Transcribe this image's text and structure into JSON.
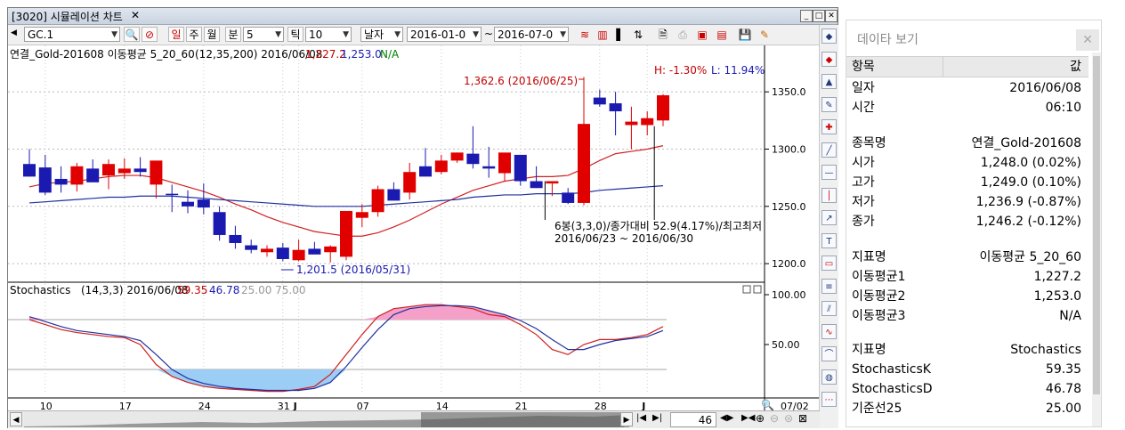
{
  "window": {
    "title": "[3020] 시뮬레이션 차트"
  },
  "toolbar": {
    "symbol": "GC.1",
    "period_day": "일",
    "period_week": "주",
    "period_month": "월",
    "period_minute": "분",
    "minute_value": "5",
    "period_tick": "틱",
    "tick_value": "10",
    "mode": "날자",
    "date_from": "2016-01-0",
    "range_sep": "~",
    "date_to": "2016-07-0"
  },
  "main_chart": {
    "legend_name": "연결_Gold-201608 이동평균 5_20_60",
    "legend_params": "(12,35,200) 2016/06/08",
    "legend_v1": "1,227.2",
    "legend_v2": "1,253.0",
    "legend_v3": "N/A",
    "high_pct": "H: -1.30%",
    "low_pct": "L: 11.94%",
    "max_label": "1,362.6 (2016/06/25)",
    "min_label": "1,201.5 (2016/05/31)",
    "annot_line1": "6봉(3,3,0)/종가대비 52.9(4.17%)/최고최저",
    "annot_line2": "2016/06/23 ~ 2016/06/30",
    "y_ticks": [
      "1350.0",
      "1300.0",
      "1250.0",
      "1200.0"
    ]
  },
  "sub_chart": {
    "legend_name": "Stochastics",
    "legend_params": "(14,3,3) 2016/06/08",
    "legend_k": "59.35",
    "legend_d": "46.78",
    "legend_base": "25.00 75.00",
    "y_ticks": [
      "100.00",
      "50.00"
    ]
  },
  "x_axis": {
    "labels": [
      "10",
      "17",
      "24",
      "31",
      "J",
      "07",
      "14",
      "21",
      "28",
      "J"
    ],
    "end_label": "07/02"
  },
  "scroll": {
    "count": "46"
  },
  "chart_data": [
    {
      "type": "candlestick",
      "title": "연결_Gold-201608",
      "ylim": [
        1190,
        1375
      ],
      "x": [
        "05/09",
        "05/10",
        "05/11",
        "05/12",
        "05/13",
        "05/16",
        "05/17",
        "05/18",
        "05/19",
        "05/20",
        "05/23",
        "05/24",
        "05/25",
        "05/26",
        "05/27",
        "05/30",
        "05/31",
        "06/01",
        "06/02",
        "06/03",
        "06/06",
        "06/07",
        "06/08",
        "06/09",
        "06/10",
        "06/13",
        "06/14",
        "06/15",
        "06/16",
        "06/17",
        "06/20",
        "06/21",
        "06/22",
        "06/23",
        "06/24",
        "06/25",
        "06/27",
        "06/28",
        "06/29",
        "06/30",
        "07/01"
      ],
      "open": [
        1287,
        1284,
        1274,
        1269,
        1283,
        1277,
        1279,
        1283,
        1269,
        1261,
        1254,
        1256,
        1245,
        1225,
        1216,
        1210,
        1214,
        1203,
        1213,
        1210,
        1206,
        1240,
        1245,
        1265,
        1262,
        1285,
        1280,
        1290,
        1296,
        1285,
        1279,
        1295,
        1272,
        1270,
        1262,
        1253,
        1345,
        1340,
        1321,
        1321,
        1325
      ],
      "high": [
        1300,
        1295,
        1285,
        1288,
        1291,
        1291,
        1292,
        1293,
        1282,
        1269,
        1264,
        1270,
        1250,
        1233,
        1221,
        1216,
        1218,
        1221,
        1219,
        1216,
        1246,
        1252,
        1268,
        1271,
        1288,
        1301,
        1295,
        1297,
        1320,
        1302,
        1292,
        1295,
        1285,
        1272,
        1266,
        1363,
        1352,
        1350,
        1337,
        1333,
        1348
      ],
      "low": [
        1276,
        1260,
        1262,
        1263,
        1274,
        1265,
        1274,
        1276,
        1257,
        1245,
        1244,
        1243,
        1220,
        1213,
        1209,
        1206,
        1202,
        1202,
        1209,
        1201,
        1203,
        1232,
        1241,
        1257,
        1256,
        1280,
        1278,
        1288,
        1283,
        1275,
        1272,
        1268,
        1266,
        1259,
        1252,
        1251,
        1337,
        1312,
        1300,
        1312,
        1320
      ],
      "close": [
        1276,
        1262,
        1269,
        1285,
        1271,
        1287,
        1283,
        1280,
        1290,
        1260,
        1250,
        1249,
        1225,
        1218,
        1212,
        1213,
        1204,
        1212,
        1208,
        1215,
        1246,
        1245,
        1265,
        1255,
        1280,
        1276,
        1290,
        1297,
        1287,
        1283,
        1297,
        1272,
        1266,
        1272,
        1253,
        1322,
        1339,
        1333,
        1324,
        1327,
        1347
      ],
      "series": [
        {
          "name": "이동평균1",
          "values": [
            1267,
            1270,
            1271,
            1272,
            1274,
            1276,
            1277,
            1277,
            1275,
            1271,
            1267,
            1263,
            1258,
            1252,
            1247,
            1241,
            1236,
            1232,
            1228,
            1226,
            1224,
            1224,
            1227,
            1232,
            1238,
            1245,
            1252,
            1258,
            1264,
            1268,
            1272,
            1274,
            1276,
            1276,
            1277,
            1283,
            1290,
            1296,
            1298,
            1300,
            1303
          ]
        },
        {
          "name": "이동평균2",
          "values": [
            1253,
            1254,
            1255,
            1256,
            1257,
            1258,
            1258,
            1259,
            1259,
            1259,
            1258,
            1257,
            1256,
            1255,
            1254,
            1253,
            1252,
            1251,
            1250,
            1250,
            1250,
            1250,
            1251,
            1252,
            1253,
            1254,
            1255,
            1256,
            1258,
            1259,
            1260,
            1260,
            1261,
            1261,
            1261,
            1262,
            1264,
            1265,
            1266,
            1267,
            1268
          ]
        }
      ]
    },
    {
      "type": "line",
      "title": "Stochastics",
      "ylim": [
        0,
        100
      ],
      "x": [
        "05/09",
        "05/10",
        "05/11",
        "05/12",
        "05/13",
        "05/16",
        "05/17",
        "05/18",
        "05/19",
        "05/20",
        "05/23",
        "05/24",
        "05/25",
        "05/26",
        "05/27",
        "05/30",
        "05/31",
        "06/01",
        "06/02",
        "06/03",
        "06/06",
        "06/07",
        "06/08",
        "06/09",
        "06/10",
        "06/13",
        "06/14",
        "06/15",
        "06/16",
        "06/17",
        "06/20",
        "06/21",
        "06/22",
        "06/23",
        "06/24",
        "06/25",
        "06/27",
        "06/28",
        "06/29",
        "06/30",
        "07/01"
      ],
      "series": [
        {
          "name": "StochasticsK",
          "values": [
            75,
            70,
            65,
            62,
            60,
            58,
            57,
            50,
            30,
            18,
            12,
            8,
            6,
            5,
            4,
            3,
            3,
            5,
            8,
            20,
            40,
            60,
            78,
            86,
            88,
            90,
            90,
            88,
            86,
            80,
            78,
            70,
            60,
            45,
            40,
            50,
            55,
            55,
            57,
            60,
            68
          ]
        },
        {
          "name": "StochasticsD",
          "values": [
            78,
            73,
            68,
            64,
            62,
            60,
            58,
            54,
            40,
            25,
            16,
            11,
            8,
            6,
            5,
            4,
            4,
            4,
            6,
            12,
            28,
            47,
            65,
            80,
            86,
            88,
            89,
            89,
            88,
            84,
            80,
            74,
            66,
            55,
            45,
            45,
            50,
            54,
            56,
            58,
            64
          ]
        }
      ],
      "levels": [
        25,
        75
      ]
    }
  ],
  "data_panel": {
    "title": "데이타 보기",
    "header_key": "항목",
    "header_val": "값",
    "date_key": "일자",
    "date_val": "2016/06/08",
    "time_key": "시간",
    "time_val": "06:10",
    "name_key": "종목명",
    "name_val": "연결_Gold-201608",
    "open_key": "시가",
    "open_val": "1,248.0 (0.02%)",
    "high_key": "고가",
    "high_val": "1,249.0 (0.10%)",
    "low_key": "저가",
    "low_val": "1,236.9 (-0.87%)",
    "close_key": "종가",
    "close_val": "1,246.2 (-0.12%)",
    "ind1_key": "지표명",
    "ind1_val": "이동평균 5_20_60",
    "ma1_key": "이동평균1",
    "ma1_val": "1,227.2",
    "ma2_key": "이동평균2",
    "ma2_val": "1,253.0",
    "ma3_key": "이동평균3",
    "ma3_val": "N/A",
    "ind2_key": "지표명",
    "ind2_val": "Stochastics",
    "k_key": "StochasticsK",
    "k_val": "59.35",
    "d_key": "StochasticsD",
    "d_val": "46.78",
    "base_key": "기준선25",
    "base_val": "25.00"
  },
  "colors": {
    "up": "#e00000",
    "down": "#1a1ab0",
    "ma1": "#d02020",
    "ma2": "#2030a0",
    "fill_high": "#f5a0c8",
    "fill_low": "#9ccdf5"
  }
}
